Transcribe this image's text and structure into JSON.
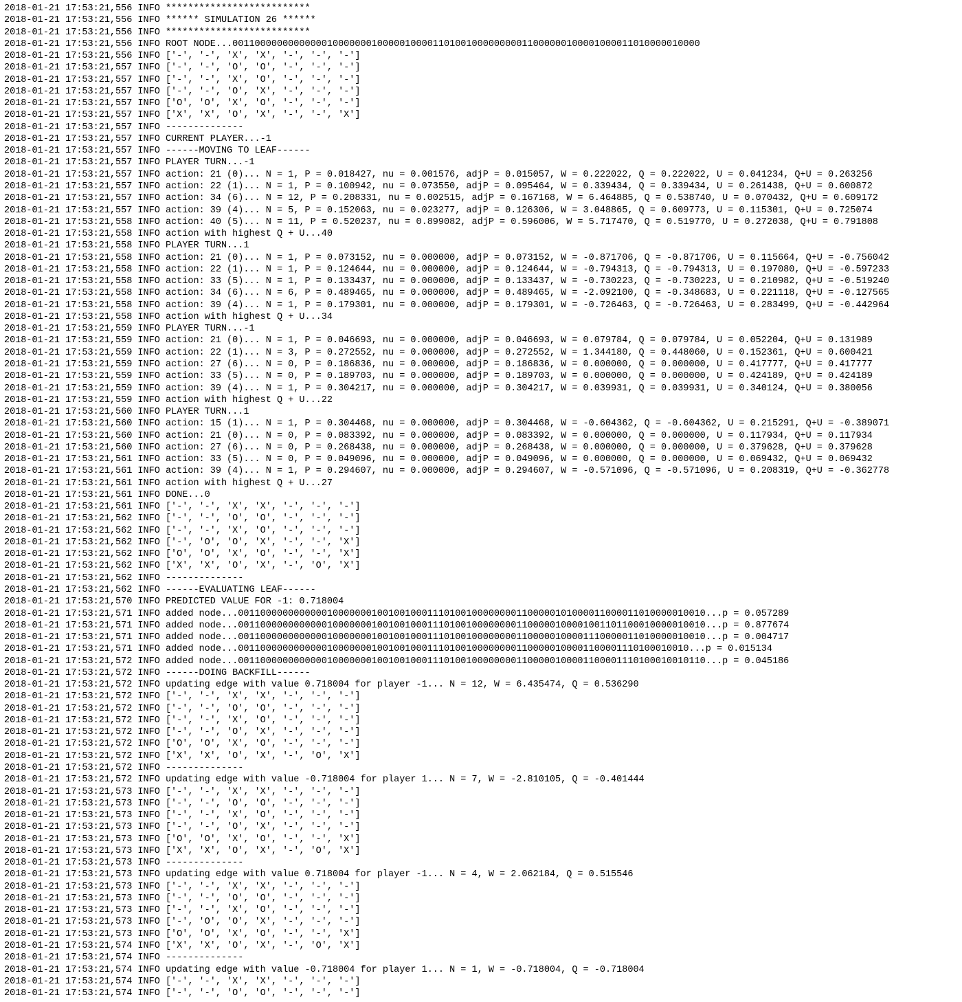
{
  "lines": [
    {
      "ts": "2018-01-21 17:53:21,556",
      "lvl": "INFO",
      "msg": "**************************"
    },
    {
      "ts": "2018-01-21 17:53:21,556",
      "lvl": "INFO",
      "msg": "****** SIMULATION 26 ******"
    },
    {
      "ts": "2018-01-21 17:53:21,556",
      "lvl": "INFO",
      "msg": "**************************"
    },
    {
      "ts": "2018-01-21 17:53:21,556",
      "lvl": "INFO",
      "msg": "ROOT NODE...001100000000000001000000010000010000110100100000000011000000100001000011010000010000"
    },
    {
      "ts": "2018-01-21 17:53:21,556",
      "lvl": "INFO",
      "msg": "['-', '-', 'X', 'X', '-', '-', '-']"
    },
    {
      "ts": "2018-01-21 17:53:21,557",
      "lvl": "INFO",
      "msg": "['-', '-', 'O', 'O', '-', '-', '-']"
    },
    {
      "ts": "2018-01-21 17:53:21,557",
      "lvl": "INFO",
      "msg": "['-', '-', 'X', 'O', '-', '-', '-']"
    },
    {
      "ts": "2018-01-21 17:53:21,557",
      "lvl": "INFO",
      "msg": "['-', '-', 'O', 'X', '-', '-', '-']"
    },
    {
      "ts": "2018-01-21 17:53:21,557",
      "lvl": "INFO",
      "msg": "['O', 'O', 'X', 'O', '-', '-', '-']"
    },
    {
      "ts": "2018-01-21 17:53:21,557",
      "lvl": "INFO",
      "msg": "['X', 'X', 'O', 'X', '-', '-', 'X']"
    },
    {
      "ts": "2018-01-21 17:53:21,557",
      "lvl": "INFO",
      "msg": "--------------"
    },
    {
      "ts": "2018-01-21 17:53:21,557",
      "lvl": "INFO",
      "msg": "CURRENT PLAYER...-1"
    },
    {
      "ts": "2018-01-21 17:53:21,557",
      "lvl": "INFO",
      "msg": "------MOVING TO LEAF------"
    },
    {
      "ts": "2018-01-21 17:53:21,557",
      "lvl": "INFO",
      "msg": "PLAYER TURN...-1"
    },
    {
      "ts": "2018-01-21 17:53:21,557",
      "lvl": "INFO",
      "msg": "action: 21 (0)... N = 1, P = 0.018427, nu = 0.001576, adjP = 0.015057, W = 0.222022, Q = 0.222022, U = 0.041234, Q+U = 0.263256"
    },
    {
      "ts": "2018-01-21 17:53:21,557",
      "lvl": "INFO",
      "msg": "action: 22 (1)... N = 1, P = 0.100942, nu = 0.073550, adjP = 0.095464, W = 0.339434, Q = 0.339434, U = 0.261438, Q+U = 0.600872"
    },
    {
      "ts": "2018-01-21 17:53:21,557",
      "lvl": "INFO",
      "msg": "action: 34 (6)... N = 12, P = 0.208331, nu = 0.002515, adjP = 0.167168, W = 6.464885, Q = 0.538740, U = 0.070432, Q+U = 0.609172"
    },
    {
      "ts": "2018-01-21 17:53:21,557",
      "lvl": "INFO",
      "msg": "action: 39 (4)... N = 5, P = 0.152063, nu = 0.023277, adjP = 0.126306, W = 3.048865, Q = 0.609773, U = 0.115301, Q+U = 0.725074"
    },
    {
      "ts": "2018-01-21 17:53:21,558",
      "lvl": "INFO",
      "msg": "action: 40 (5)... N = 11, P = 0.520237, nu = 0.899082, adjP = 0.596006, W = 5.717470, Q = 0.519770, U = 0.272038, Q+U = 0.791808"
    },
    {
      "ts": "2018-01-21 17:53:21,558",
      "lvl": "INFO",
      "msg": "action with highest Q + U...40"
    },
    {
      "ts": "2018-01-21 17:53:21,558",
      "lvl": "INFO",
      "msg": "PLAYER TURN...1"
    },
    {
      "ts": "2018-01-21 17:53:21,558",
      "lvl": "INFO",
      "msg": "action: 21 (0)... N = 1, P = 0.073152, nu = 0.000000, adjP = 0.073152, W = -0.871706, Q = -0.871706, U = 0.115664, Q+U = -0.756042"
    },
    {
      "ts": "2018-01-21 17:53:21,558",
      "lvl": "INFO",
      "msg": "action: 22 (1)... N = 1, P = 0.124644, nu = 0.000000, adjP = 0.124644, W = -0.794313, Q = -0.794313, U = 0.197080, Q+U = -0.597233"
    },
    {
      "ts": "2018-01-21 17:53:21,558",
      "lvl": "INFO",
      "msg": "action: 33 (5)... N = 1, P = 0.133437, nu = 0.000000, adjP = 0.133437, W = -0.730223, Q = -0.730223, U = 0.210982, Q+U = -0.519240"
    },
    {
      "ts": "2018-01-21 17:53:21,558",
      "lvl": "INFO",
      "msg": "action: 34 (6)... N = 6, P = 0.489465, nu = 0.000000, adjP = 0.489465, W = -2.092100, Q = -0.348683, U = 0.221118, Q+U = -0.127565"
    },
    {
      "ts": "2018-01-21 17:53:21,558",
      "lvl": "INFO",
      "msg": "action: 39 (4)... N = 1, P = 0.179301, nu = 0.000000, adjP = 0.179301, W = -0.726463, Q = -0.726463, U = 0.283499, Q+U = -0.442964"
    },
    {
      "ts": "2018-01-21 17:53:21,558",
      "lvl": "INFO",
      "msg": "action with highest Q + U...34"
    },
    {
      "ts": "2018-01-21 17:53:21,559",
      "lvl": "INFO",
      "msg": "PLAYER TURN...-1"
    },
    {
      "ts": "2018-01-21 17:53:21,559",
      "lvl": "INFO",
      "msg": "action: 21 (0)... N = 1, P = 0.046693, nu = 0.000000, adjP = 0.046693, W = 0.079784, Q = 0.079784, U = 0.052204, Q+U = 0.131989"
    },
    {
      "ts": "2018-01-21 17:53:21,559",
      "lvl": "INFO",
      "msg": "action: 22 (1)... N = 3, P = 0.272552, nu = 0.000000, adjP = 0.272552, W = 1.344180, Q = 0.448060, U = 0.152361, Q+U = 0.600421"
    },
    {
      "ts": "2018-01-21 17:53:21,559",
      "lvl": "INFO",
      "msg": "action: 27 (6)... N = 0, P = 0.186836, nu = 0.000000, adjP = 0.186836, W = 0.000000, Q = 0.000000, U = 0.417777, Q+U = 0.417777"
    },
    {
      "ts": "2018-01-21 17:53:21,559",
      "lvl": "INFO",
      "msg": "action: 33 (5)... N = 0, P = 0.189703, nu = 0.000000, adjP = 0.189703, W = 0.000000, Q = 0.000000, U = 0.424189, Q+U = 0.424189"
    },
    {
      "ts": "2018-01-21 17:53:21,559",
      "lvl": "INFO",
      "msg": "action: 39 (4)... N = 1, P = 0.304217, nu = 0.000000, adjP = 0.304217, W = 0.039931, Q = 0.039931, U = 0.340124, Q+U = 0.380056"
    },
    {
      "ts": "2018-01-21 17:53:21,559",
      "lvl": "INFO",
      "msg": "action with highest Q + U...22"
    },
    {
      "ts": "2018-01-21 17:53:21,560",
      "lvl": "INFO",
      "msg": "PLAYER TURN...1"
    },
    {
      "ts": "2018-01-21 17:53:21,560",
      "lvl": "INFO",
      "msg": "action: 15 (1)... N = 1, P = 0.304468, nu = 0.000000, adjP = 0.304468, W = -0.604362, Q = -0.604362, U = 0.215291, Q+U = -0.389071"
    },
    {
      "ts": "2018-01-21 17:53:21,560",
      "lvl": "INFO",
      "msg": "action: 21 (0)... N = 0, P = 0.083392, nu = 0.000000, adjP = 0.083392, W = 0.000000, Q = 0.000000, U = 0.117934, Q+U = 0.117934"
    },
    {
      "ts": "2018-01-21 17:53:21,560",
      "lvl": "INFO",
      "msg": "action: 27 (6)... N = 0, P = 0.268438, nu = 0.000000, adjP = 0.268438, W = 0.000000, Q = 0.000000, U = 0.379628, Q+U = 0.379628"
    },
    {
      "ts": "2018-01-21 17:53:21,561",
      "lvl": "INFO",
      "msg": "action: 33 (5)... N = 0, P = 0.049096, nu = 0.000000, adjP = 0.049096, W = 0.000000, Q = 0.000000, U = 0.069432, Q+U = 0.069432"
    },
    {
      "ts": "2018-01-21 17:53:21,561",
      "lvl": "INFO",
      "msg": "action: 39 (4)... N = 1, P = 0.294607, nu = 0.000000, adjP = 0.294607, W = -0.571096, Q = -0.571096, U = 0.208319, Q+U = -0.362778"
    },
    {
      "ts": "2018-01-21 17:53:21,561",
      "lvl": "INFO",
      "msg": "action with highest Q + U...27"
    },
    {
      "ts": "2018-01-21 17:53:21,561",
      "lvl": "INFO",
      "msg": "DONE...0"
    },
    {
      "ts": "2018-01-21 17:53:21,561",
      "lvl": "INFO",
      "msg": "['-', '-', 'X', 'X', '-', '-', '-']"
    },
    {
      "ts": "2018-01-21 17:53:21,562",
      "lvl": "INFO",
      "msg": "['-', '-', 'O', 'O', '-', '-', '-']"
    },
    {
      "ts": "2018-01-21 17:53:21,562",
      "lvl": "INFO",
      "msg": "['-', '-', 'X', 'O', '-', '-', '-']"
    },
    {
      "ts": "2018-01-21 17:53:21,562",
      "lvl": "INFO",
      "msg": "['-', 'O', 'O', 'X', '-', '-', 'X']"
    },
    {
      "ts": "2018-01-21 17:53:21,562",
      "lvl": "INFO",
      "msg": "['O', 'O', 'X', 'O', '-', '-', 'X']"
    },
    {
      "ts": "2018-01-21 17:53:21,562",
      "lvl": "INFO",
      "msg": "['X', 'X', 'O', 'X', '-', 'O', 'X']"
    },
    {
      "ts": "2018-01-21 17:53:21,562",
      "lvl": "INFO",
      "msg": "--------------"
    },
    {
      "ts": "2018-01-21 17:53:21,562",
      "lvl": "INFO",
      "msg": "------EVALUATING LEAF------"
    },
    {
      "ts": "2018-01-21 17:53:21,570",
      "lvl": "INFO",
      "msg": "PREDICTED VALUE FOR -1: 0.718004"
    },
    {
      "ts": "2018-01-21 17:53:21,571",
      "lvl": "INFO",
      "msg": "added node...001100000000000010000000100100100011101001000000001100000101000011000011010000010010...p = 0.057289"
    },
    {
      "ts": "2018-01-21 17:53:21,571",
      "lvl": "INFO",
      "msg": "added node...001100000000000010000000100100100011101001000000001100000100001001101100010000010010...p = 0.877674"
    },
    {
      "ts": "2018-01-21 17:53:21,571",
      "lvl": "INFO",
      "msg": "added node...001100000000000010000000100100100011101001000000001100000100001110000011010000010010...p = 0.004717"
    },
    {
      "ts": "2018-01-21 17:53:21,571",
      "lvl": "INFO",
      "msg": "added node...001100000000000010000000100100100011101001000000001100000100001100001110100010010...p = 0.015134"
    },
    {
      "ts": "2018-01-21 17:53:21,572",
      "lvl": "INFO",
      "msg": "added node...001100000000000010000000100100100011101001000000001100000100001100001110100010010110...p = 0.045186"
    },
    {
      "ts": "2018-01-21 17:53:21,572",
      "lvl": "INFO",
      "msg": "------DOING BACKFILL------"
    },
    {
      "ts": "2018-01-21 17:53:21,572",
      "lvl": "INFO",
      "msg": "updating edge with value 0.718004 for player -1... N = 12, W = 6.435474, Q = 0.536290"
    },
    {
      "ts": "2018-01-21 17:53:21,572",
      "lvl": "INFO",
      "msg": "['-', '-', 'X', 'X', '-', '-', '-']"
    },
    {
      "ts": "2018-01-21 17:53:21,572",
      "lvl": "INFO",
      "msg": "['-', '-', 'O', 'O', '-', '-', '-']"
    },
    {
      "ts": "2018-01-21 17:53:21,572",
      "lvl": "INFO",
      "msg": "['-', '-', 'X', 'O', '-', '-', '-']"
    },
    {
      "ts": "2018-01-21 17:53:21,572",
      "lvl": "INFO",
      "msg": "['-', '-', 'O', 'X', '-', '-', '-']"
    },
    {
      "ts": "2018-01-21 17:53:21,572",
      "lvl": "INFO",
      "msg": "['O', 'O', 'X', 'O', '-', '-', '-']"
    },
    {
      "ts": "2018-01-21 17:53:21,572",
      "lvl": "INFO",
      "msg": "['X', 'X', 'O', 'X', '-', 'O', 'X']"
    },
    {
      "ts": "2018-01-21 17:53:21,572",
      "lvl": "INFO",
      "msg": "--------------"
    },
    {
      "ts": "2018-01-21 17:53:21,572",
      "lvl": "INFO",
      "msg": "updating edge with value -0.718004 for player 1... N = 7, W = -2.810105, Q = -0.401444"
    },
    {
      "ts": "2018-01-21 17:53:21,573",
      "lvl": "INFO",
      "msg": "['-', '-', 'X', 'X', '-', '-', '-']"
    },
    {
      "ts": "2018-01-21 17:53:21,573",
      "lvl": "INFO",
      "msg": "['-', '-', 'O', 'O', '-', '-', '-']"
    },
    {
      "ts": "2018-01-21 17:53:21,573",
      "lvl": "INFO",
      "msg": "['-', '-', 'X', 'O', '-', '-', '-']"
    },
    {
      "ts": "2018-01-21 17:53:21,573",
      "lvl": "INFO",
      "msg": "['-', '-', 'O', 'X', '-', '-', '-']"
    },
    {
      "ts": "2018-01-21 17:53:21,573",
      "lvl": "INFO",
      "msg": "['O', 'O', 'X', 'O', '-', '-', 'X']"
    },
    {
      "ts": "2018-01-21 17:53:21,573",
      "lvl": "INFO",
      "msg": "['X', 'X', 'O', 'X', '-', 'O', 'X']"
    },
    {
      "ts": "2018-01-21 17:53:21,573",
      "lvl": "INFO",
      "msg": "--------------"
    },
    {
      "ts": "2018-01-21 17:53:21,573",
      "lvl": "INFO",
      "msg": "updating edge with value 0.718004 for player -1... N = 4, W = 2.062184, Q = 0.515546"
    },
    {
      "ts": "2018-01-21 17:53:21,573",
      "lvl": "INFO",
      "msg": "['-', '-', 'X', 'X', '-', '-', '-']"
    },
    {
      "ts": "2018-01-21 17:53:21,573",
      "lvl": "INFO",
      "msg": "['-', '-', 'O', 'O', '-', '-', '-']"
    },
    {
      "ts": "2018-01-21 17:53:21,573",
      "lvl": "INFO",
      "msg": "['-', '-', 'X', 'O', '-', '-', '-']"
    },
    {
      "ts": "2018-01-21 17:53:21,573",
      "lvl": "INFO",
      "msg": "['-', 'O', 'O', 'X', '-', '-', '-']"
    },
    {
      "ts": "2018-01-21 17:53:21,573",
      "lvl": "INFO",
      "msg": "['O', 'O', 'X', 'O', '-', '-', 'X']"
    },
    {
      "ts": "2018-01-21 17:53:21,574",
      "lvl": "INFO",
      "msg": "['X', 'X', 'O', 'X', '-', 'O', 'X']"
    },
    {
      "ts": "2018-01-21 17:53:21,574",
      "lvl": "INFO",
      "msg": "--------------"
    },
    {
      "ts": "2018-01-21 17:53:21,574",
      "lvl": "INFO",
      "msg": "updating edge with value -0.718004 for player 1... N = 1, W = -0.718004, Q = -0.718004"
    },
    {
      "ts": "2018-01-21 17:53:21,574",
      "lvl": "INFO",
      "msg": "['-', '-', 'X', 'X', '-', '-', '-']"
    },
    {
      "ts": "2018-01-21 17:53:21,574",
      "lvl": "INFO",
      "msg": "['-', '-', 'O', 'O', '-', '-', '-']"
    }
  ]
}
